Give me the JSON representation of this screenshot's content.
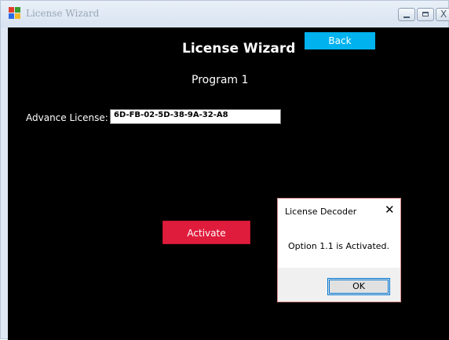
{
  "window": {
    "title": "License Wizard",
    "close_glyph": "X"
  },
  "header": {
    "title": "License Wizard",
    "subtitle": "Program 1",
    "back_label": "Back"
  },
  "license": {
    "label": "Advance License:",
    "value": "6D-FB-02-5D-38-9A-32-A8"
  },
  "actions": {
    "activate_label": "Activate"
  },
  "dialog": {
    "title": "License Decoder",
    "close_glyph": "✕",
    "message": "Option 1.1 is Activated.",
    "ok_label": "OK"
  },
  "colors": {
    "background": "#000000",
    "back_button": "#00b3ef",
    "activate_button": "#e01c3c",
    "dialog_focus": "#0078d7"
  },
  "icons": {
    "app": "license-wizard-app-icon"
  }
}
